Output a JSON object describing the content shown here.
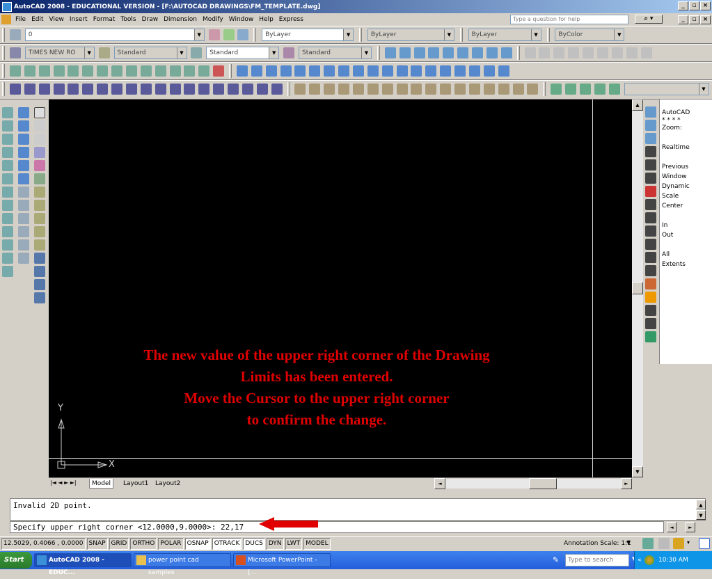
{
  "title": "AutoCAD 2008 - EDUCATIONAL VERSION - [F:\\AUTOCAD DRAWINGS\\FM_TEMPLATE.dwg]",
  "menu": [
    "File",
    "Edit",
    "View",
    "Insert",
    "Format",
    "Tools",
    "Draw",
    "Dimension",
    "Modify",
    "Window",
    "Help",
    "Express"
  ],
  "help_placeholder": "Type a question for help",
  "layers": {
    "current": "0",
    "color": "ByLayer",
    "linetype": "ByLayer",
    "lineweight": "ByLayer",
    "plotstyle": "ByColor"
  },
  "styles": {
    "font": "TIMES NEW RO",
    "text_style": "Standard",
    "dim_style": "Standard",
    "multileader": "Standard"
  },
  "zoom_panel": [
    "AutoCAD",
    "* * * *",
    "Zoom:",
    "",
    "Realtime",
    "",
    "Previous",
    "Window",
    "Dynamic",
    "Scale",
    "Center",
    "",
    "In",
    "Out",
    "",
    "All",
    "Extents"
  ],
  "overlay": [
    "The new value of the upper right corner of the Drawing",
    "Limits has been entered.",
    "Move the Cursor to the upper right corner",
    "to confirm the change."
  ],
  "ucs": {
    "x": "X",
    "y": "Y"
  },
  "tabs": [
    "Model",
    "Layout1",
    "Layout2"
  ],
  "command": {
    "history": "Invalid 2D point.",
    "line": "Specify upper right corner <12.0000,9.0000>: 22,17"
  },
  "status": {
    "coords": "12.5029, 0.4066 , 0.0000",
    "toggles": [
      "SNAP",
      "GRID",
      "ORTHO",
      "POLAR",
      "OSNAP",
      "OTRACK",
      "DUCS",
      "DYN",
      "LWT",
      "MODEL"
    ],
    "annotation_scale": "Annotation Scale: 1:1"
  },
  "taskbar": {
    "start": "Start",
    "tasks": [
      "AutoCAD 2008 - EDUC...",
      "power point cad samples",
      "Microsoft PowerPoint - [..."
    ],
    "search": "Type to search",
    "clock": "10:30 AM"
  },
  "colors": {
    "accent_red": "#e00000",
    "canvas": "#000000"
  }
}
